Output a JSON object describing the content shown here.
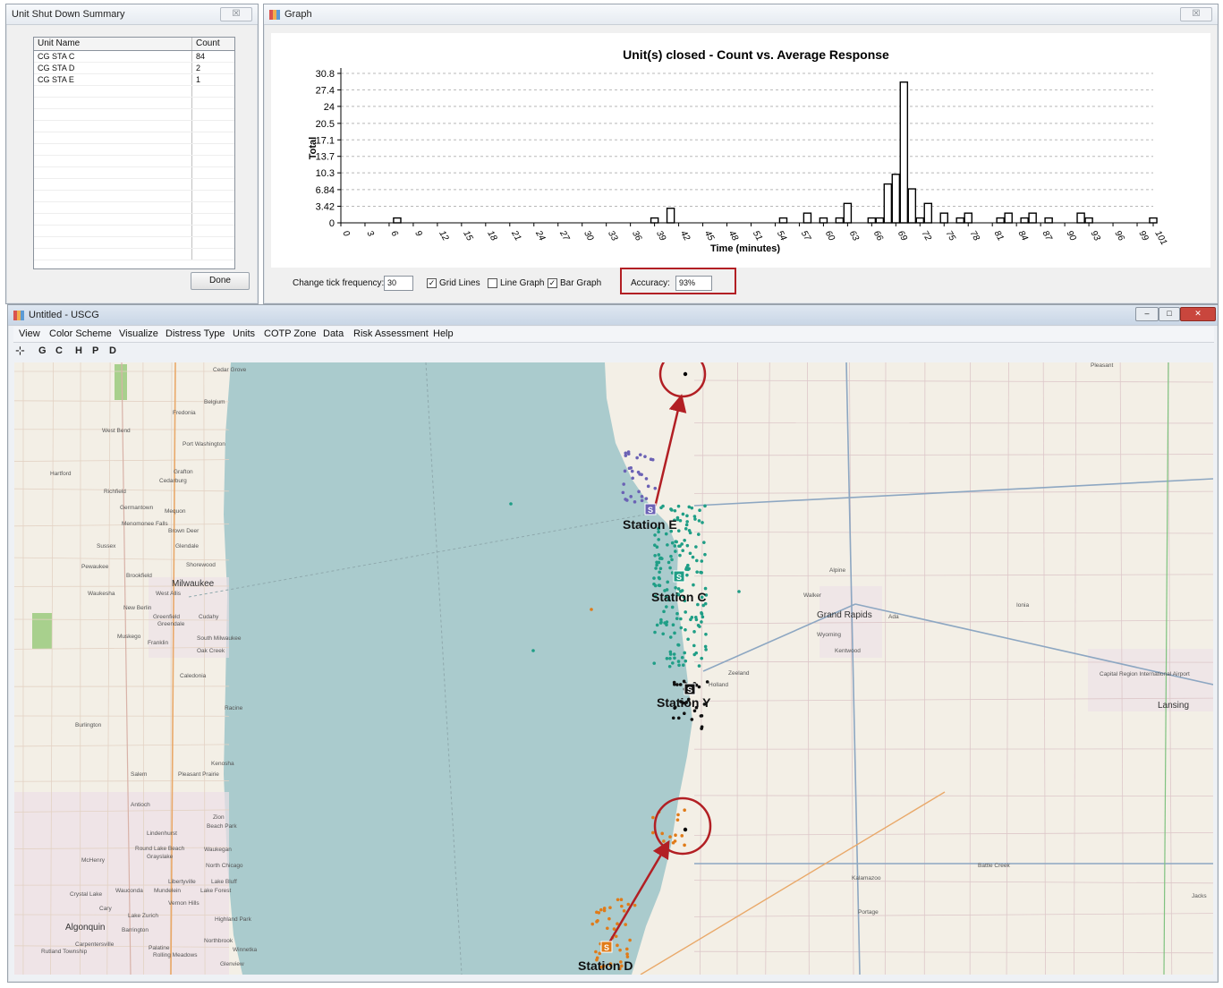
{
  "summary": {
    "title": "Unit Shut Down Summary",
    "close_label": "☒",
    "columns": [
      "Unit Name",
      "Count"
    ],
    "rows": [
      {
        "name": "CG STA C",
        "count": "84"
      },
      {
        "name": "CG STA D",
        "count": "2"
      },
      {
        "name": "CG STA E",
        "count": "1"
      }
    ],
    "done_label": "Done"
  },
  "graph_window": {
    "title": "Graph",
    "close_label": "☒",
    "controls": {
      "tick_label": "Change tick frequency:",
      "tick_value": "30",
      "grid_lines_label": "Grid Lines",
      "grid_lines_checked": true,
      "line_graph_label": "Line Graph",
      "line_graph_checked": false,
      "bar_graph_label": "Bar Graph",
      "bar_graph_checked": true,
      "accuracy_label": "Accuracy:",
      "accuracy_value": "93%"
    }
  },
  "chart_data": {
    "type": "bar",
    "title": "Unit(s) closed - Count vs. Average Response",
    "xlabel": "Time (minutes)",
    "ylabel": "Total",
    "x_ticks": [
      "0",
      "3",
      "6",
      "9",
      "12",
      "15",
      "18",
      "21",
      "24",
      "27",
      "30",
      "33",
      "36",
      "39",
      "42",
      "45",
      "48",
      "51",
      "54",
      "57",
      "60",
      "63",
      "66",
      "69",
      "72",
      "75",
      "78",
      "81",
      "84",
      "87",
      "90",
      "93",
      "96",
      "99",
      "101"
    ],
    "y_ticks": [
      "0",
      "3.42",
      "6.84",
      "10.3",
      "13.7",
      "17.1",
      "20.5",
      "24",
      "27.4",
      "30.8"
    ],
    "xlim": [
      0,
      101
    ],
    "ylim": [
      0,
      30.8
    ],
    "grid": true,
    "bar_color": "#ffffff",
    "bar_edge_color": "#000000",
    "x": [
      7,
      39,
      41,
      55,
      58,
      60,
      62,
      63,
      66,
      67,
      68,
      69,
      70,
      71,
      72,
      73,
      75,
      77,
      78,
      82,
      83,
      85,
      86,
      88,
      92,
      93,
      101
    ],
    "values": [
      1,
      1,
      3,
      1,
      2,
      1,
      1,
      4,
      1,
      1,
      8,
      10,
      29,
      7,
      1,
      4,
      2,
      1,
      2,
      1,
      2,
      1,
      2,
      1,
      2,
      1,
      1
    ]
  },
  "main": {
    "title": "Untitled - USCG",
    "menu": [
      "View",
      "Color Scheme",
      "Visualize",
      "Distress Type",
      "Units",
      "COTP Zone",
      "Data",
      "Risk Assessment",
      "Help"
    ],
    "toolbar": [
      "G",
      "C",
      "H",
      "P",
      "D"
    ],
    "window_controls": {
      "minimize": "–",
      "maximize": "□",
      "close": "✕"
    }
  },
  "map": {
    "lake_color": "#aacbcd",
    "land_color": "#f3efe6",
    "stations": [
      {
        "label": "Station E",
        "marker": "S",
        "color": "#6b62b5"
      },
      {
        "label": "Station C",
        "marker": "S",
        "color": "#1f9e86"
      },
      {
        "label": "Station Y",
        "marker": "S",
        "color": "#111111"
      },
      {
        "label": "Station D",
        "marker": "S",
        "color": "#e07b19"
      }
    ],
    "places": [
      "Cedar Grove",
      "Belgium",
      "Fredonia",
      "West Bend",
      "Port Washington",
      "Hartford",
      "Grafton",
      "Cedarburg",
      "Richfield",
      "Germantown",
      "Mequon",
      "Menomonee Falls",
      "Brown Deer",
      "Glendale",
      "Sussex",
      "Shorewood",
      "Pewaukee",
      "Brookfield",
      "Milwaukee",
      "Waukesha",
      "West Allis",
      "New Berlin",
      "Greenfield",
      "Greendale",
      "Cudahy",
      "Muskego",
      "Franklin",
      "South Milwaukee",
      "Oak Creek",
      "Caledonia",
      "Racine",
      "Burlington",
      "Kenosha",
      "Salem",
      "Pleasant Prairie",
      "Antioch",
      "Zion",
      "Beach Park",
      "Lindenhurst",
      "Round Lake Beach",
      "Grayslake",
      "Waukegan",
      "North Chicago",
      "McHenry",
      "Libertyville",
      "Lake Bluff",
      "Crystal Lake",
      "Wauconda",
      "Mundelein",
      "Lake Forest",
      "Vernon Hills",
      "Cary",
      "Lake Zurich",
      "Highland Park",
      "Algonquin",
      "Barrington",
      "Carpentersville",
      "Northbrook",
      "Rutland Township",
      "Palatine",
      "Rolling Meadows",
      "Winnetka",
      "Glenview",
      "Grand Rapids",
      "Alpine",
      "Walker",
      "Ada",
      "Wyoming",
      "Kentwood",
      "Zeeland",
      "Holland",
      "Ionia",
      "Lansing",
      "Capital Region International Airport",
      "Kalamazoo",
      "Portage",
      "Battle Creek",
      "Jacks",
      "Pleasant"
    ]
  }
}
